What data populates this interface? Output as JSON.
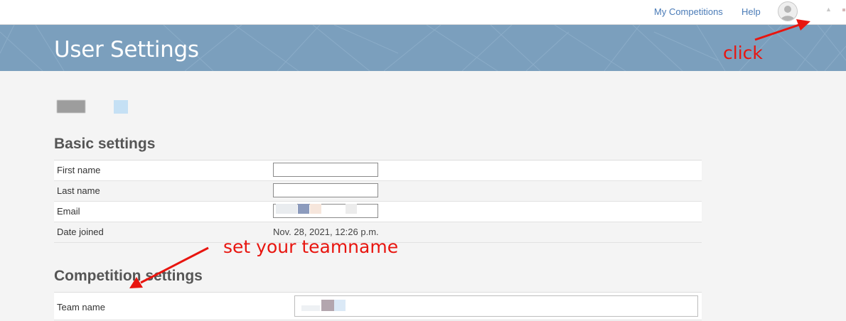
{
  "nav": {
    "my_competitions": "My Competitions",
    "help": "Help",
    "avatar_icon": "user-avatar-icon",
    "dropdown_icon": "chevron-down-icon"
  },
  "banner": {
    "title": "User Settings",
    "color": "#7b9fbd"
  },
  "annotations": {
    "click": "click",
    "set_teamname": "set your teamname",
    "color": "#e8150f"
  },
  "basic_settings": {
    "heading": "Basic settings",
    "first_name": {
      "label": "First name",
      "value": ""
    },
    "last_name": {
      "label": "Last name",
      "value": ""
    },
    "email": {
      "label": "Email",
      "value": ""
    },
    "date_joined": {
      "label": "Date joined",
      "value": "Nov. 28, 2021, 12:26 p.m."
    }
  },
  "competition_settings": {
    "heading": "Competition settings",
    "team_name": {
      "label": "Team name",
      "value": ""
    }
  },
  "colors": {
    "link": "#4a7bb7",
    "heading": "#555555"
  }
}
